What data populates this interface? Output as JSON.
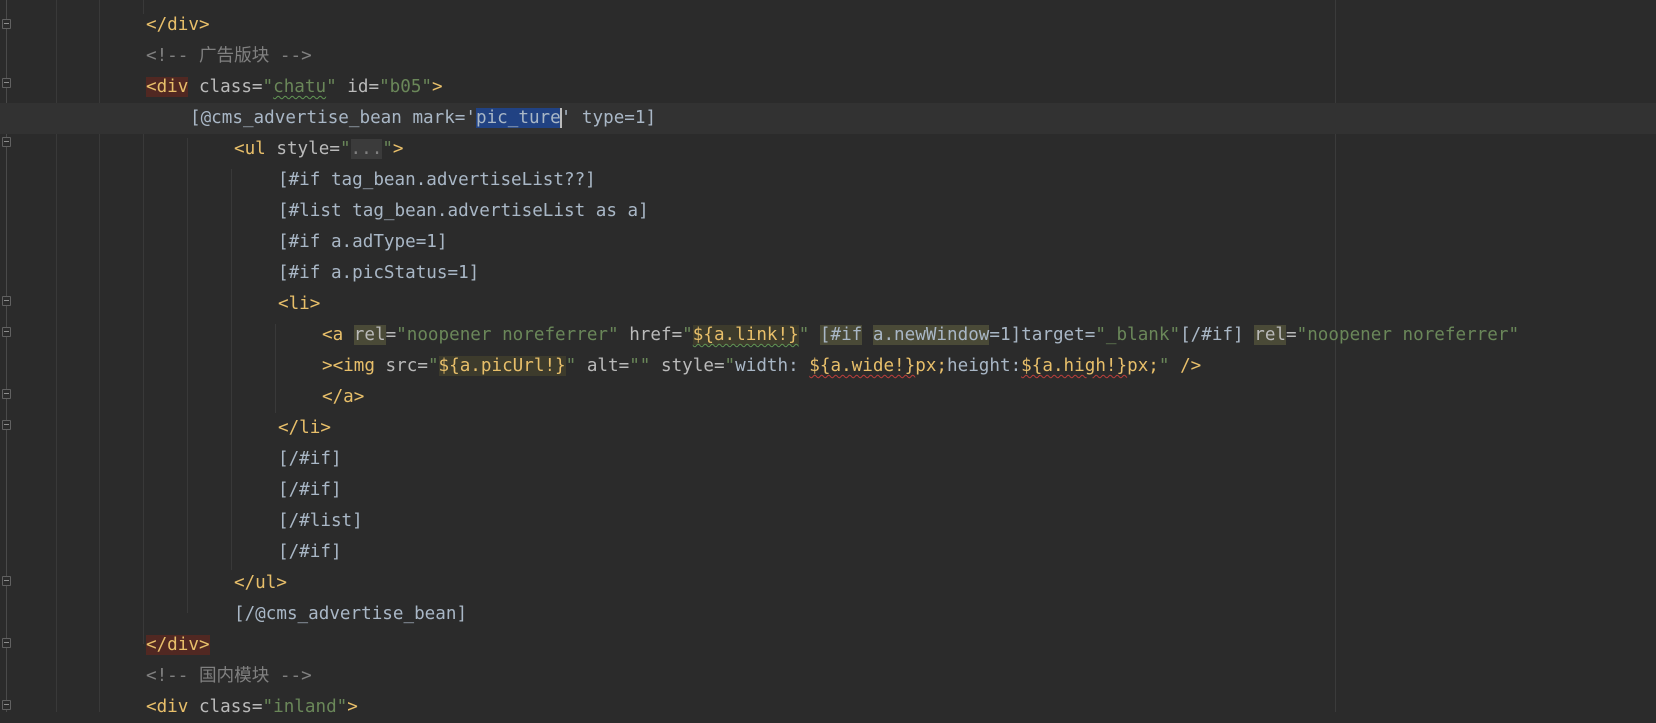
{
  "editor": {
    "lines": [
      {
        "t1": "</div>"
      },
      {
        "t1": "<!-- 广告版块 -->"
      },
      {
        "t1": "<div",
        "t2": " class=",
        "t3": "\"",
        "t4": "chatu",
        "t5": "\"",
        "t6": " id=",
        "t7": "\"b05\"",
        "t8": ">"
      },
      {
        "t1": "[@cms_advertise_bean mark='",
        "t2": "pic_ture",
        "t3": "' type=1]"
      },
      {
        "t1": "<ul",
        "t2": " style=",
        "t3": "\"",
        "t4": "...",
        "t5": "\"",
        "t6": ">"
      },
      {
        "t1": "[#if tag_bean.advertiseList??]"
      },
      {
        "t1": "[#list tag_bean.advertiseList as a]"
      },
      {
        "t1": "[#if a.adType=1]"
      },
      {
        "t1": "[#if a.picStatus=1]"
      },
      {
        "t1": "<li>"
      },
      {
        "t1": "<a ",
        "t2": "rel",
        "t3": "=",
        "t4": "\"noopener noreferrer\"",
        "t5": " href=",
        "t6": "\"",
        "t7": "${a.link!}",
        "t8": "\"",
        "t9": " ",
        "t10": "[#if",
        "t11": " ",
        "t12": "a.newWindow",
        "t13": "=1]target=",
        "t14": "\"_blank\"",
        "t15": "[/#if] ",
        "t16": "rel",
        "t17": "=",
        "t18": "\"noopener noreferrer\""
      },
      {
        "t1": "><img",
        "t2": " src=",
        "t3": "\"",
        "t4": "${a.picUrl!}",
        "t5": "\"",
        "t6": " alt=",
        "t7": "\"\"",
        "t8": " style=",
        "t9": "\"",
        "t10": "width: ",
        "t11": "${a.wide!}",
        "t12": "px",
        "t13": ";",
        "t14": "height:",
        "t15": "${a.high!}",
        "t16": "px",
        "t17": ";",
        "t18": "\"",
        "t19": " />"
      },
      {
        "t1": "</a>"
      },
      {
        "t1": "</li>"
      },
      {
        "t1": "[/#if]"
      },
      {
        "t1": "[/#if]"
      },
      {
        "t1": "[/#list]"
      },
      {
        "t1": "[/#if]"
      },
      {
        "t1": "</ul>"
      },
      {
        "t1": "[/@cms_advertise_bean]"
      },
      {
        "t1": "</div>"
      },
      {
        "t1": "<!-- 国内模块 -->"
      },
      {
        "t1": "<div",
        "t2": " class=",
        "t3": "\"inland\"",
        "t4": ">"
      }
    ]
  }
}
